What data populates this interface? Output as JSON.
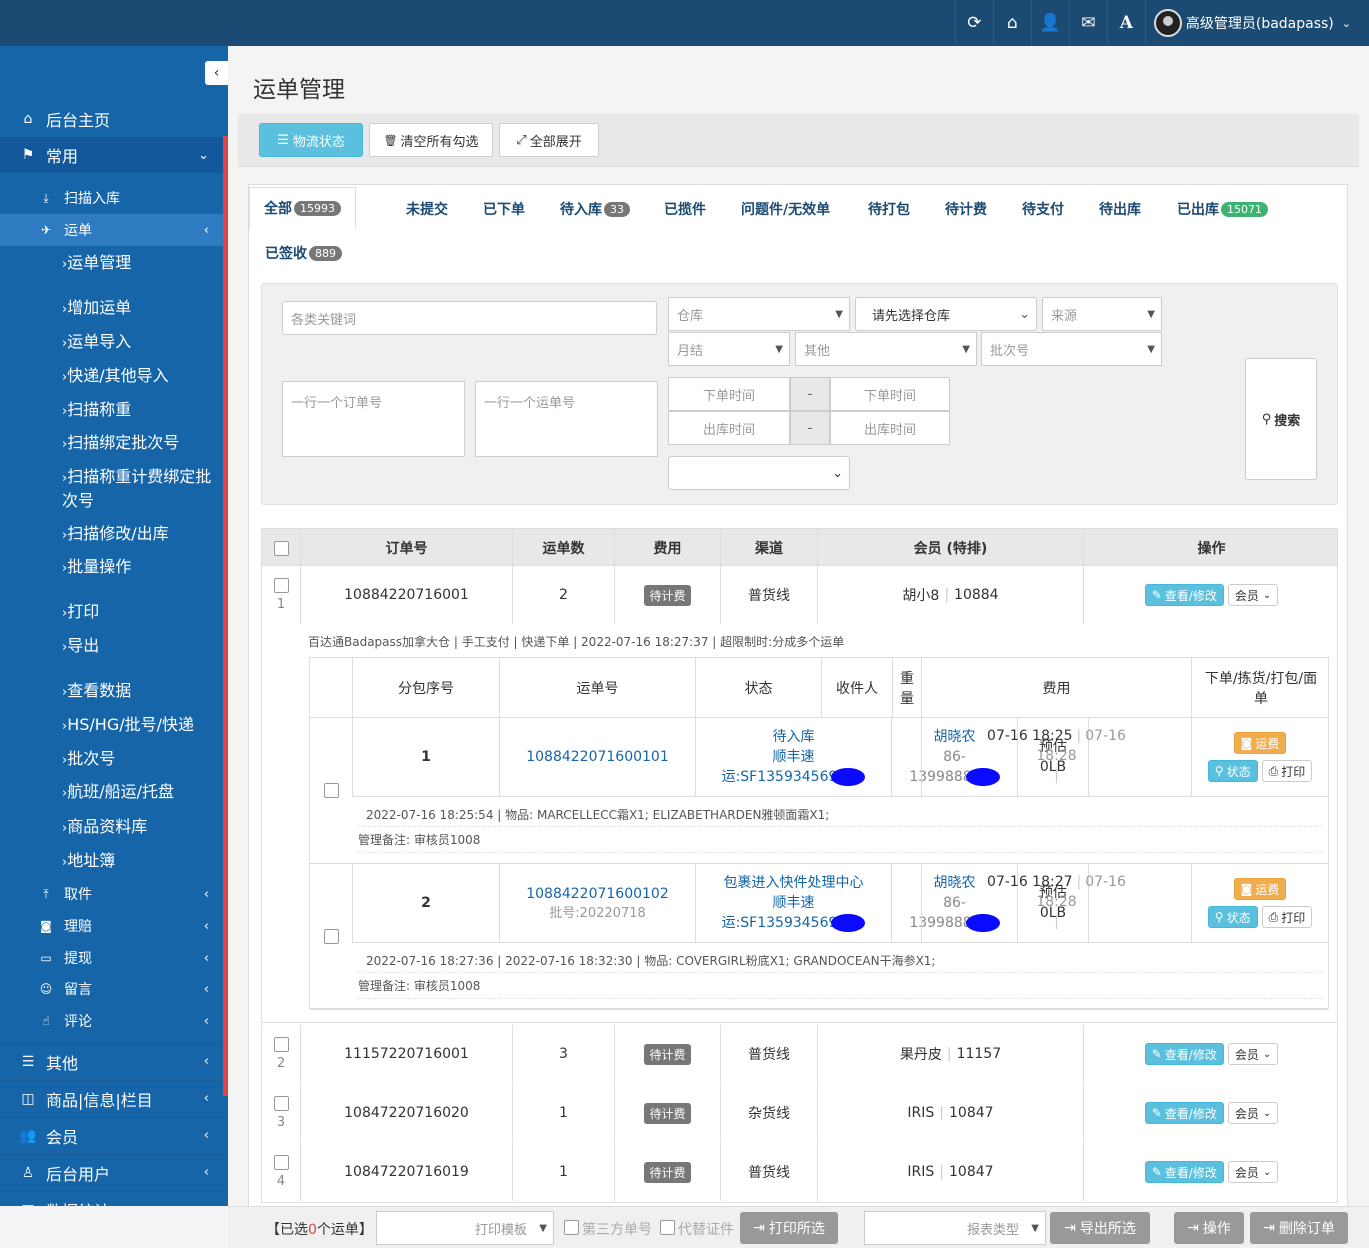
{
  "user": {
    "name": "高级管理员(badapass)"
  },
  "sidebar": {
    "top": [
      {
        "label": "后台主页"
      },
      {
        "label": "常用"
      }
    ],
    "sub": [
      {
        "label": "扫描入库"
      },
      {
        "label": "运单"
      }
    ],
    "waybill_items": [
      {
        "label": "运单管理"
      },
      {
        "label": "增加运单"
      },
      {
        "label": "运单导入"
      },
      {
        "label": "快递/其他导入"
      },
      {
        "label": "扫描称重"
      },
      {
        "label": "扫描绑定批次号"
      },
      {
        "label": "扫描称重计费绑定批次号"
      },
      {
        "label": "扫描修改/出库"
      },
      {
        "label": "批量操作"
      },
      {
        "label": "打印"
      },
      {
        "label": "导出"
      },
      {
        "label": "查看数据"
      },
      {
        "label": "HS/HG/批号/快递"
      },
      {
        "label": "批次号"
      },
      {
        "label": "航班/船运/托盘"
      },
      {
        "label": "商品资料库"
      },
      {
        "label": "地址簿"
      }
    ],
    "more": [
      {
        "label": "取件"
      },
      {
        "label": "理赔"
      },
      {
        "label": "提现"
      },
      {
        "label": "留言"
      },
      {
        "label": "评论"
      }
    ],
    "bottom": [
      {
        "label": "其他"
      },
      {
        "label": "商品|信息|栏目"
      },
      {
        "label": "会员"
      },
      {
        "label": "后台用户"
      },
      {
        "label": "数据统计"
      }
    ]
  },
  "page": {
    "title": "运单管理"
  },
  "toolbar": {
    "logistics": "物流状态",
    "clear": "清空所有勾选",
    "expand": "全部展开"
  },
  "tabs": [
    {
      "label": "全部",
      "badge": "15993"
    },
    {
      "label": "未提交"
    },
    {
      "label": "已下单"
    },
    {
      "label": "待入库",
      "badge": "33"
    },
    {
      "label": "已揽件"
    },
    {
      "label": "问题件/无效单"
    },
    {
      "label": "待打包"
    },
    {
      "label": "待计费"
    },
    {
      "label": "待支付"
    },
    {
      "label": "待出库"
    },
    {
      "label": "已出库",
      "badge": "15071"
    },
    {
      "label": "已签收",
      "badge": "889"
    }
  ],
  "filters": {
    "keyword": "各类关键词",
    "warehouse": "仓库",
    "choose_wh": "请先选择仓库",
    "source": "来源",
    "monthly": "月结",
    "other": "其他",
    "batch": "批次号",
    "order_lines": "一行一个订单号",
    "waybill_lines": "一行一个运单号",
    "order_time": "下单时间",
    "out_time": "出库时间",
    "dash": "-",
    "search": "搜索"
  },
  "table": {
    "headers": [
      "订单号",
      "运单数",
      "费用",
      "渠道",
      "会员 (特排)",
      "操作"
    ],
    "edit": "查看/修改",
    "member": "会员"
  },
  "orders": [
    {
      "idx": "1",
      "order": "10884220716001",
      "count": "2",
      "fee": "待计费",
      "channel": "普货线",
      "member": "胡小8",
      "member_id": "10884"
    },
    {
      "idx": "2",
      "order": "11157220716001",
      "count": "3",
      "fee": "待计费",
      "channel": "普货线",
      "member": "果丹皮",
      "member_id": "11157"
    },
    {
      "idx": "3",
      "order": "10847220716020",
      "count": "1",
      "fee": "待计费",
      "channel": "杂货线",
      "member": "IRIS",
      "member_id": "10847"
    },
    {
      "idx": "4",
      "order": "10847220716019",
      "count": "1",
      "fee": "待计费",
      "channel": "普货线",
      "member": "IRIS",
      "member_id": "10847"
    }
  ],
  "detail": {
    "meta": "百达通Badapass加拿大仓 | 手工支付 | 快递下单 | 2022-07-16 18:27:37 | 超限制时:分成多个运单",
    "headers": [
      "分包序号",
      "运单号",
      "状态",
      "收件人",
      "重量",
      "费用",
      "下单/拣货/打包/面单",
      "操作"
    ],
    "btn_fee": "运费",
    "btn_status": "状态",
    "btn_print": "打印",
    "packages": [
      {
        "seq": "1",
        "waybill": "1088422071600101",
        "batch": "",
        "status1": "待入库",
        "status2": "顺丰速",
        "status3": "运:SF135934569",
        "recv": "胡晓农",
        "recv2": "86-",
        "recv3": "1399888",
        "weight1": "预估",
        "weight2": "0LB",
        "time1": "07-16 18:25",
        "time2": "07-16",
        "time3": "18:28",
        "info": "2022-07-16 18:25:54 | 物品: MARCELLECC霜X1; ELIZABETHARDEN雅顿面霜X1;",
        "admin": "管理备注: 审核员1008"
      },
      {
        "seq": "2",
        "waybill": "1088422071600102",
        "batch": "批号:20220718",
        "status1": "包裹进入快件处理中心",
        "status2": "顺丰速",
        "status3": "运:SF135934569",
        "recv": "胡晓农",
        "recv2": "86-",
        "recv3": "1399888",
        "weight1": "预估",
        "weight2": "0LB",
        "time1": "07-16 18:27",
        "time2": "07-16",
        "time3": "18:28",
        "info": "2022-07-16 18:27:36 | 2022-07-16 18:32:30 | 物品: COVERGIRL粉底X1; GRANDOCEAN干海参X1;",
        "admin": "管理备注: 审核员1008"
      }
    ]
  },
  "bottom": {
    "selected_pre": "【已选",
    "selected_num": "0",
    "selected_post": "个运单】",
    "print_tpl": "打印模板",
    "third": "第三方单号",
    "proxy": "代替证件",
    "print_sel": "打印所选",
    "report": "报表类型",
    "export_sel": "导出所选",
    "op": "操作",
    "del": "删除订单"
  }
}
